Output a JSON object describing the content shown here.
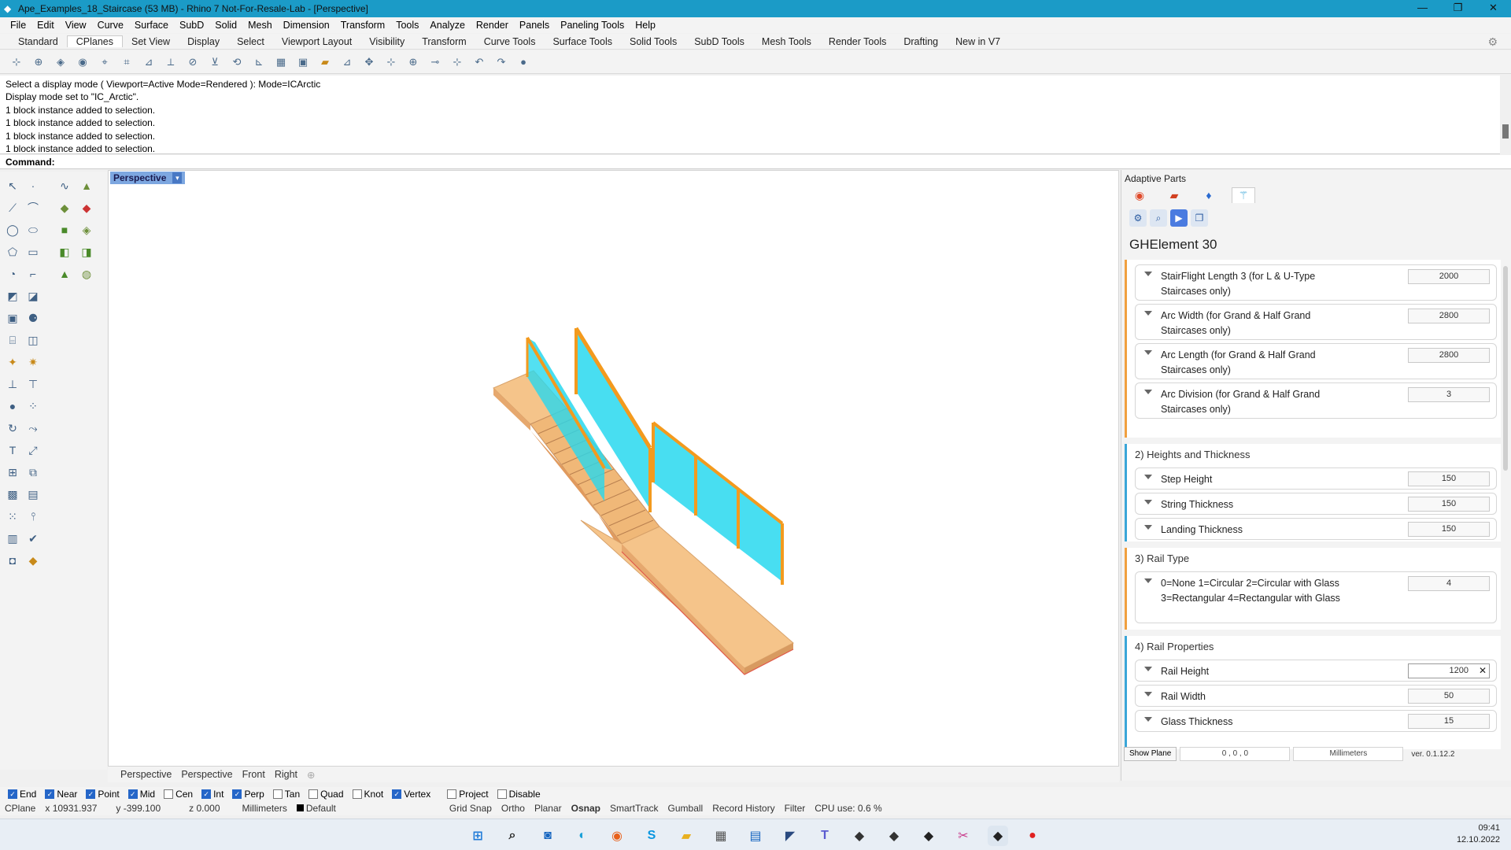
{
  "window": {
    "title": "Ape_Examples_18_Staircase (53 MB) - Rhino 7 Not-For-Resale-Lab - [Perspective]",
    "controls": [
      "—",
      "❐",
      "✕"
    ]
  },
  "menu": [
    "File",
    "Edit",
    "View",
    "Curve",
    "Surface",
    "SubD",
    "Solid",
    "Mesh",
    "Dimension",
    "Transform",
    "Tools",
    "Analyze",
    "Render",
    "Panels",
    "Paneling Tools",
    "Help"
  ],
  "tabs": [
    "Standard",
    "CPlanes",
    "Set View",
    "Display",
    "Select",
    "Viewport Layout",
    "Visibility",
    "Transform",
    "Curve Tools",
    "Surface Tools",
    "Solid Tools",
    "SubD Tools",
    "Mesh Tools",
    "Render Tools",
    "Drafting",
    "New in V7"
  ],
  "command_history": [
    "Select a display mode ( Viewport=Active  Mode=Rendered ): Mode=ICArctic",
    "Display mode set to \"IC_Arctic\".",
    "1 block instance added to selection.",
    "1 block instance added to selection.",
    "1 block instance added to selection.",
    "1 block instance added to selection."
  ],
  "command_prompt": "Command:",
  "viewport": {
    "label": "Perspective"
  },
  "viewport_tabs": [
    "Perspective",
    "Perspective",
    "Front",
    "Right"
  ],
  "panel": {
    "title": "Adaptive Parts",
    "element_title": "GHElement 30",
    "groups": [
      {
        "title": "",
        "rows": [
          {
            "label": "StairFlight Length 3 (for L & U-Type Staircases only)",
            "value": "2000"
          },
          {
            "label": "Arc Width (for Grand & Half Grand Staircases only)",
            "value": "2800"
          },
          {
            "label": "Arc Length (for Grand & Half Grand Staircases only)",
            "value": "2800"
          },
          {
            "label": "Arc Division (for Grand & Half Grand Staircases only)",
            "value": "3"
          }
        ]
      },
      {
        "title": "2) Heights and Thickness",
        "rows": [
          {
            "label": "Step Height",
            "value": "150"
          },
          {
            "label": "String Thickness",
            "value": "150"
          },
          {
            "label": "Landing Thickness",
            "value": "150"
          }
        ]
      },
      {
        "title": "3) Rail Type",
        "rows": [
          {
            "label": "0=None 1=Circular 2=Circular with Glass 3=Rectangular 4=Rectangular with Glass",
            "value": "4"
          }
        ]
      },
      {
        "title": "4) Rail Properties",
        "rows": [
          {
            "label": "Rail Height",
            "value": "1200"
          },
          {
            "label": "Rail Width",
            "value": "50"
          },
          {
            "label": "Glass Thickness",
            "value": "15"
          }
        ]
      }
    ],
    "bottom": {
      "show_plane": "Show Plane",
      "origin": "0 , 0 , 0",
      "units": "Millimeters",
      "version": "ver. 0.1.12.2"
    }
  },
  "osnap": [
    {
      "label": "End",
      "checked": true
    },
    {
      "label": "Near",
      "checked": true
    },
    {
      "label": "Point",
      "checked": true
    },
    {
      "label": "Mid",
      "checked": true
    },
    {
      "label": "Cen",
      "checked": false
    },
    {
      "label": "Int",
      "checked": true
    },
    {
      "label": "Perp",
      "checked": true
    },
    {
      "label": "Tan",
      "checked": false
    },
    {
      "label": "Quad",
      "checked": false
    },
    {
      "label": "Knot",
      "checked": false
    },
    {
      "label": "Vertex",
      "checked": true
    },
    {
      "label": "Project",
      "checked": false
    },
    {
      "label": "Disable",
      "checked": false
    }
  ],
  "status": {
    "cplane": "CPlane",
    "x": "x 10931.937",
    "y": "y -399.100",
    "z": "z 0.000",
    "units": "Millimeters",
    "layer": "Default",
    "toggles": [
      "Grid Snap",
      "Ortho",
      "Planar",
      "Osnap",
      "SmartTrack",
      "Gumball",
      "Record History",
      "Filter"
    ],
    "cpu": "CPU use: 0.6 %"
  },
  "taskbar": {
    "time": "09:41",
    "date": "12.10.2022"
  },
  "colors": {
    "titlebar": "#1b9bc7",
    "orange": "#f39a1e",
    "glass": "#28d8ee",
    "wood": "#f5c48a"
  }
}
